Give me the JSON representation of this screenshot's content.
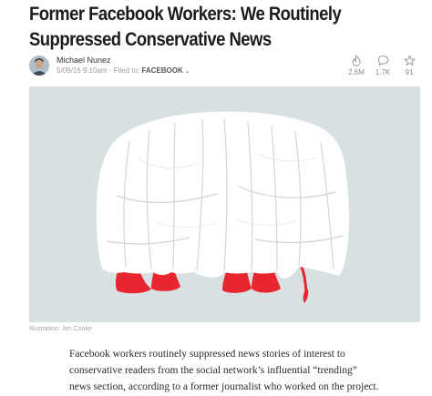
{
  "article": {
    "headline_lines": [
      "Former Facebook Workers: We Routinely",
      "Suppressed Conservative News"
    ],
    "author": "Michael Nunez",
    "date": "5/09/16 9:10am",
    "filed_prefix": "Filed to:",
    "category": "FACEBOOK",
    "stats": {
      "views": "2.6M",
      "comments": "1.7K",
      "recommends": "91"
    },
    "image_caption": "Illustration: Jim Cooke",
    "body_lines": [
      "Facebook workers routinely suppressed news stories of interest to",
      "conservative readers from the social network’s influential “trending”",
      "news section, according to a former journalist who worked on the project."
    ]
  },
  "icons": {
    "views": "flame-icon",
    "comments": "speech-bubble-icon",
    "recommends": "star-icon",
    "category_dropdown": "chevron-down-icon"
  },
  "colors": {
    "hero_background": "#d7e1e2",
    "sheet": "#ffffff",
    "feet": "#e8262f"
  }
}
